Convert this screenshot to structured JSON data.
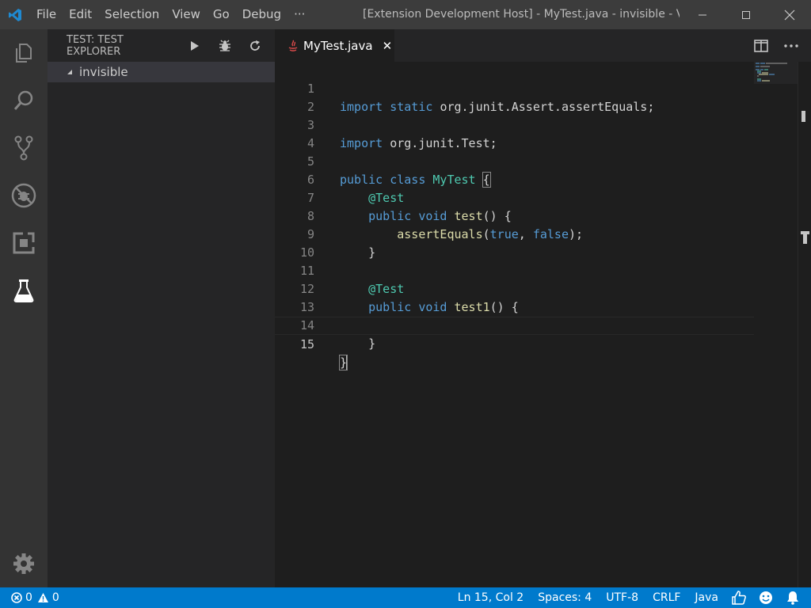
{
  "titlebar": {
    "menu": [
      "File",
      "Edit",
      "Selection",
      "View",
      "Go",
      "Debug",
      "···"
    ],
    "window_title": "[Extension Development Host] - MyTest.java - invisible - Visu..."
  },
  "activitybar": {
    "items": [
      "files-icon",
      "search-icon",
      "source-control-icon",
      "debug-icon",
      "extensions-icon",
      "test-flask-icon"
    ],
    "bottom": "gear-icon"
  },
  "sidebar": {
    "title": "TEST: TEST EXPLORER",
    "actions": [
      "play-icon",
      "debug-bug-icon",
      "refresh-icon"
    ],
    "tree": [
      {
        "label": "invisible",
        "expanded": true
      }
    ]
  },
  "editor": {
    "tab": {
      "label": "MyTest.java",
      "close": "✕",
      "icon": "java-icon"
    },
    "current_line": 15,
    "lines": [
      {
        "n": "1"
      },
      {
        "n": "2"
      },
      {
        "n": "3"
      },
      {
        "n": "4"
      },
      {
        "n": "5"
      },
      {
        "n": "6"
      },
      {
        "n": "7"
      },
      {
        "n": "8"
      },
      {
        "n": "9"
      },
      {
        "n": "10"
      },
      {
        "n": "11"
      },
      {
        "n": "12"
      },
      {
        "n": "13"
      },
      {
        "n": "14"
      },
      {
        "n": "15"
      }
    ],
    "code": {
      "l1_a": "import",
      "l1_b": "static",
      "l1_c": "org.junit.Assert.assertEquals;",
      "l3_a": "import",
      "l3_b": "org.junit.Test;",
      "l5_a": "public",
      "l5_b": "class",
      "l5_c": "MyTest",
      "l5_d": "{",
      "l6_a": "@Test",
      "l7_a": "public",
      "l7_b": "void",
      "l7_c": "test",
      "l7_d": "() {",
      "l8_a": "assertEquals",
      "l8_b": "(",
      "l8_c": "true",
      "l8_d": ", ",
      "l8_e": "false",
      "l8_f": ");",
      "l9_a": "}",
      "l11_a": "@Test",
      "l12_a": "public",
      "l12_b": "void",
      "l12_c": "test1",
      "l12_d": "() {",
      "l14_a": "}",
      "l15_a": "}"
    }
  },
  "statusbar": {
    "errors": "0",
    "warnings": "0",
    "position": "Ln 15, Col 2",
    "spaces": "Spaces: 4",
    "encoding": "UTF-8",
    "eol": "CRLF",
    "language": "Java"
  },
  "colors": {
    "statusbar": "#007acc",
    "keyword": "#569cd6",
    "type": "#4ec9b0",
    "function": "#dcdcaa"
  }
}
